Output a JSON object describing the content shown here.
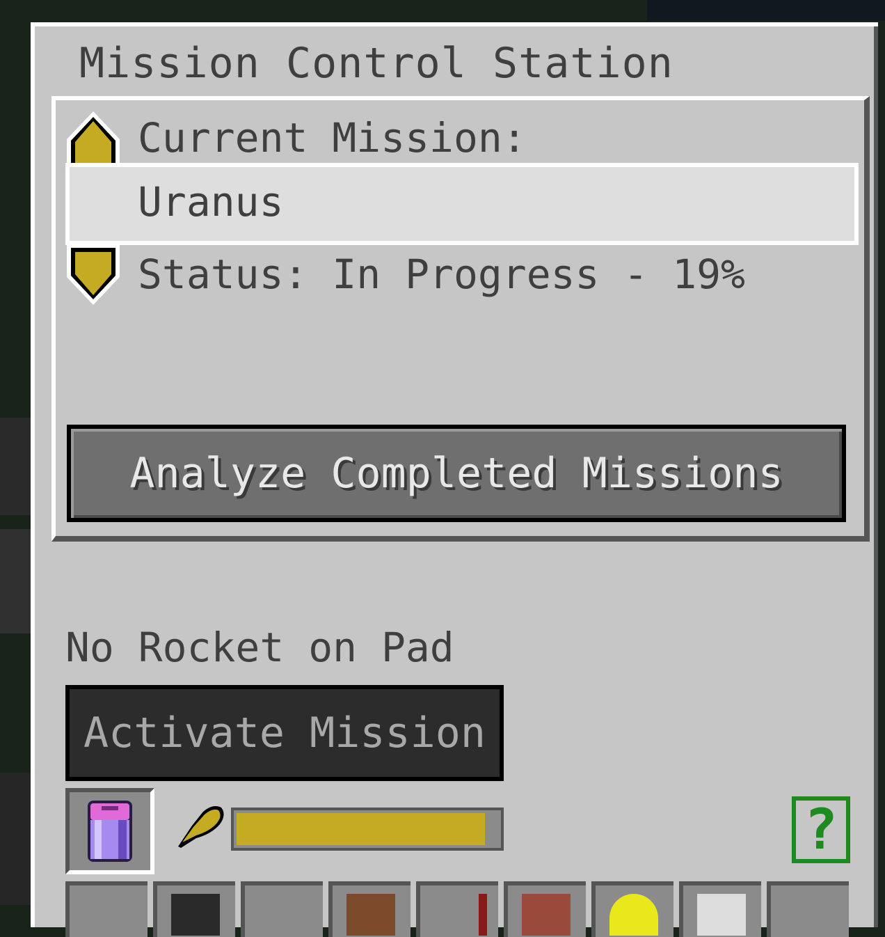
{
  "window": {
    "title": "Mission Control Station"
  },
  "mission_panel": {
    "current_label": "Current Mission:",
    "selected_mission": "Uranus",
    "status": "Status: In Progress - 19%",
    "analyze_button": "Analyze Completed Missions",
    "icons": {
      "prev": "arrow-up-icon",
      "next": "arrow-down-icon"
    }
  },
  "rocket": {
    "status_text": "No Rocket on Pad",
    "activate_button": "Activate Mission"
  },
  "fuel": {
    "slot_item_icon": "fuel-canister-icon",
    "gauge_icon": "fuel-drop-icon",
    "level_percent": 95,
    "fill_color": "#c4ab22"
  },
  "help": {
    "label": "?"
  },
  "inventory_row": [
    "empty",
    "dark-item-icon",
    "empty",
    "brown-block-icon",
    "lever-icon",
    "brick-block-icon",
    "yellow-item-icon",
    "light-block-icon",
    "empty"
  ]
}
